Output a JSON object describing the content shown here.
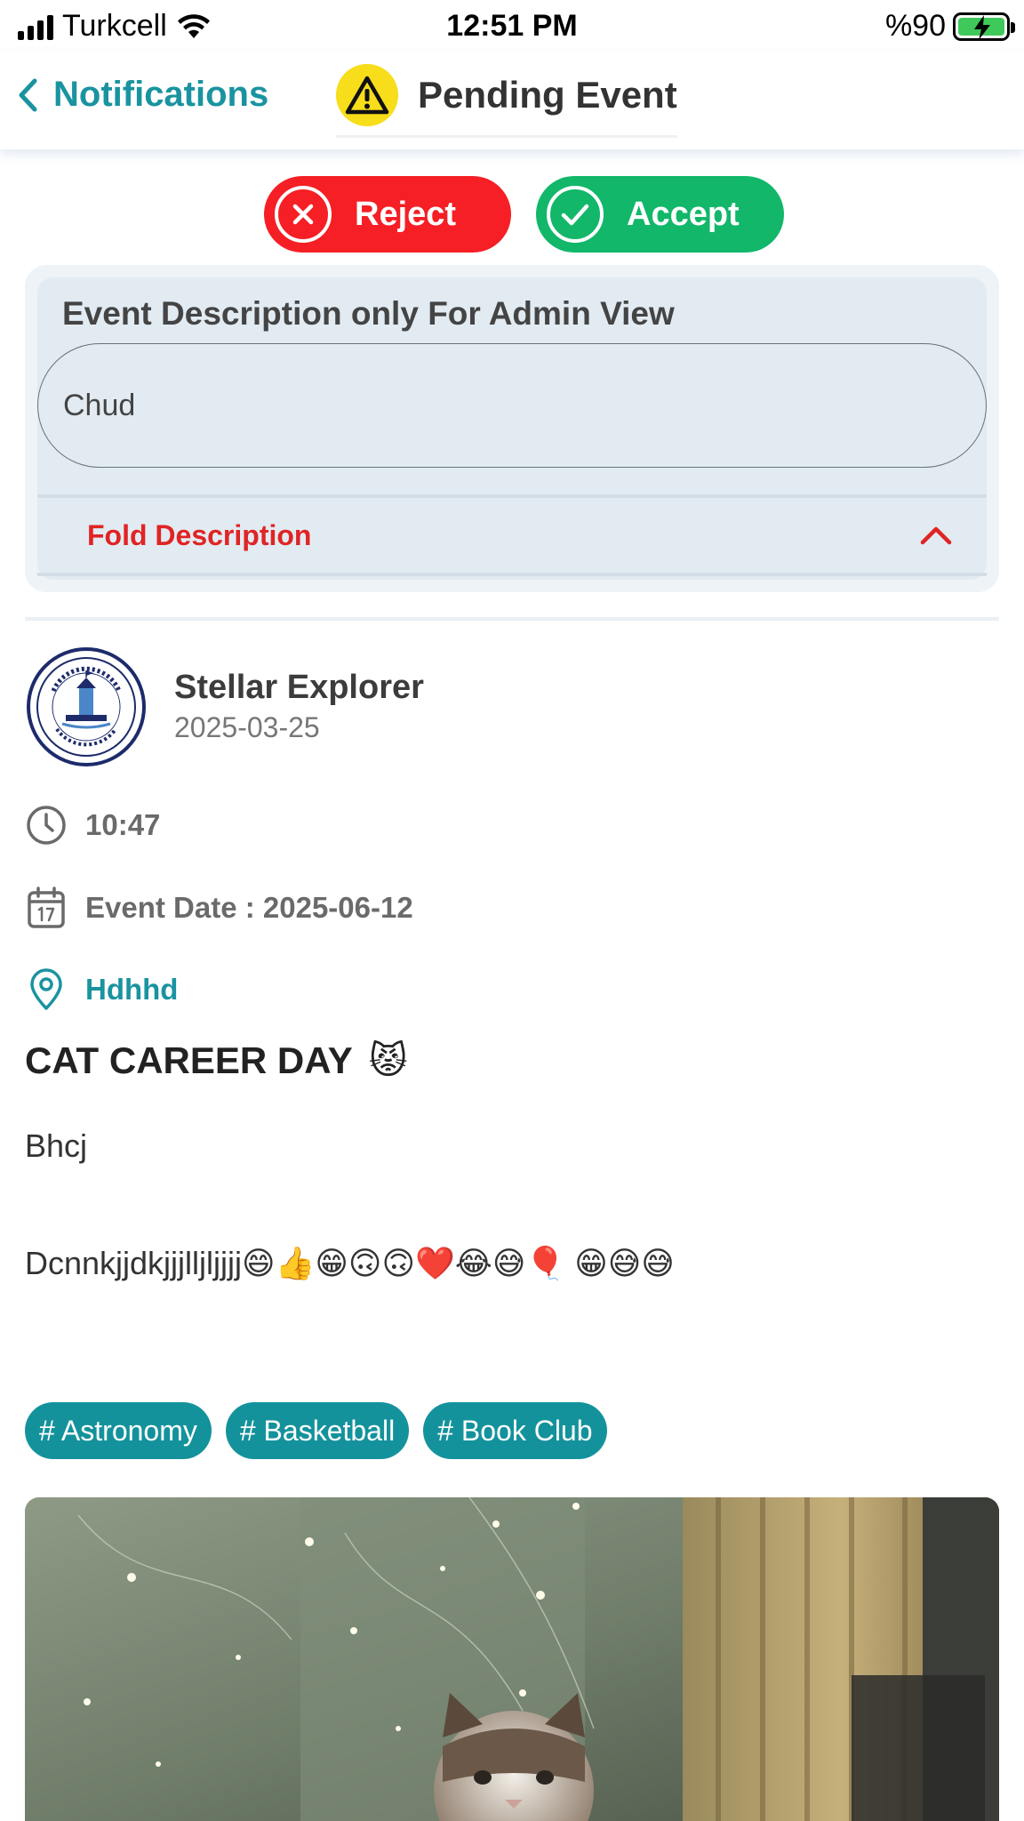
{
  "status_bar": {
    "carrier": "Turkcell",
    "time": "12:51 PM",
    "battery": "%90"
  },
  "nav": {
    "back_label": "Notifications",
    "title": "Pending Event"
  },
  "actions": {
    "reject_label": "Reject",
    "accept_label": "Accept"
  },
  "admin_description": {
    "heading": "Event Description only For Admin View",
    "value": "Chud",
    "fold_label": "Fold Description"
  },
  "organizer": {
    "name": "Stellar Explorer",
    "date": "2025-03-25"
  },
  "event": {
    "time": "10:47",
    "date_text": "Event Date : 2025-06-12",
    "location": "Hdhhd",
    "title": "CAT CAREER DAY",
    "title_emoji": "😾",
    "body_line1": "Bhcj",
    "body_line2": "Dcnnkjjdkjjjlljljjjj😄👍😁🙃🙃❤️😂😅🎈 😁😅😅"
  },
  "tags": [
    "# Astronomy",
    "# Basketball",
    "# Book Club"
  ],
  "colors": {
    "teal": "#1a93a0",
    "reject": "#f51f25",
    "accept": "#12b76a",
    "warning": "#f7dd1a"
  },
  "icons": [
    "signal-icon",
    "wifi-icon",
    "battery-icon",
    "back-chevron-icon",
    "warning-icon",
    "x-circle-icon",
    "check-circle-icon",
    "chevron-up-icon",
    "clock-icon",
    "calendar-icon",
    "location-pin-icon"
  ]
}
